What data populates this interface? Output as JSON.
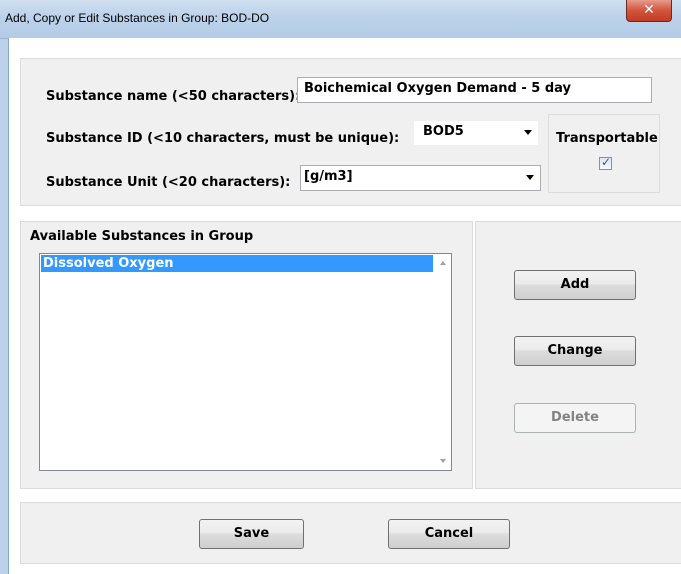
{
  "window": {
    "title": "Add, Copy or Edit Substances in Group: BOD-DO",
    "close_glyph": "✕"
  },
  "form": {
    "name_label": "Substance name (<50 characters):",
    "name_value": "Boichemical Oxygen Demand - 5 day",
    "id_label": "Substance ID (<10 characters, must be unique):",
    "id_value": "BOD5",
    "unit_label": "Substance Unit (<20 characters):",
    "unit_value": "[g/m3]",
    "transportable_label": "Transportable",
    "transportable_checked": true
  },
  "list": {
    "label": "Available Substances in Group",
    "items": [
      "Dissolved Oxygen"
    ],
    "selected_index": 0
  },
  "actions": {
    "add": "Add",
    "change": "Change",
    "delete": "Delete"
  },
  "footer": {
    "save": "Save",
    "cancel": "Cancel"
  },
  "colors": {
    "selection": "#3399ff",
    "titlebar": "#bcd2ea",
    "close_button": "#c23b22"
  }
}
